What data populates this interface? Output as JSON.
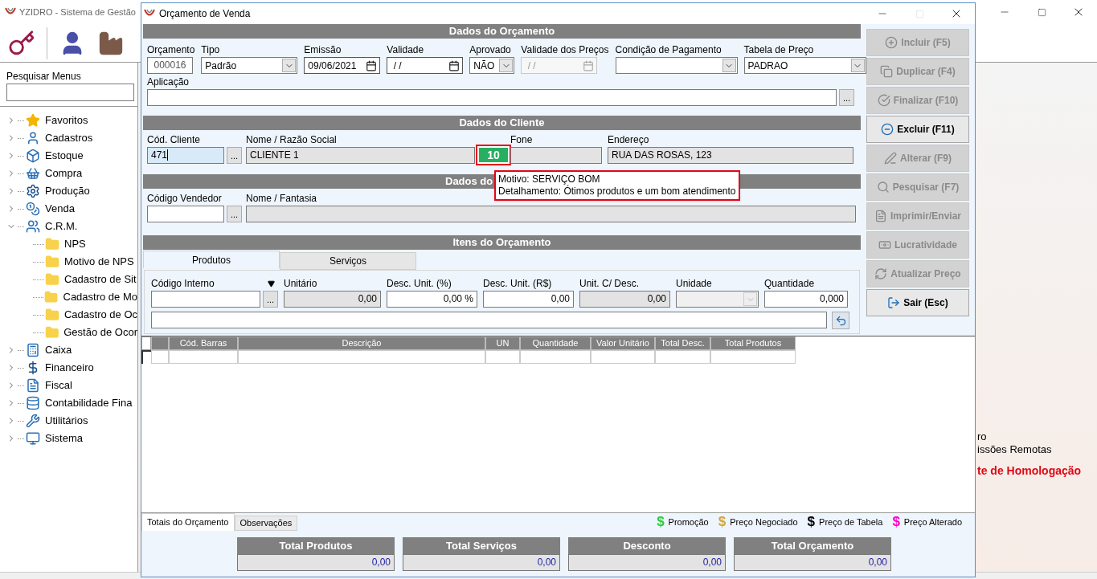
{
  "background_app": {
    "title": "YZIDRO - Sistema de Gestão",
    "search_label": "Pesquisar Menus",
    "menu_tree": [
      {
        "label": "Favoritos",
        "expanded": false
      },
      {
        "label": "Cadastros",
        "expanded": false
      },
      {
        "label": "Estoque",
        "expanded": false
      },
      {
        "label": "Compra",
        "expanded": false
      },
      {
        "label": "Produção",
        "expanded": false
      },
      {
        "label": "Venda",
        "expanded": false
      },
      {
        "label": "C.R.M.",
        "expanded": true,
        "children": [
          {
            "label": "NPS"
          },
          {
            "label": "Motivo de NPS"
          },
          {
            "label": "Cadastro de Sit"
          },
          {
            "label": "Cadastro de Mo"
          },
          {
            "label": "Cadastro de Oc"
          },
          {
            "label": "Gestão de Ocor"
          }
        ]
      },
      {
        "label": "Caixa",
        "expanded": false
      },
      {
        "label": "Financeiro",
        "expanded": false
      },
      {
        "label": "Fiscal",
        "expanded": false
      },
      {
        "label": "Contabilidade Fina",
        "expanded": false
      },
      {
        "label": "Utilitários",
        "expanded": false
      },
      {
        "label": "Sistema",
        "expanded": false
      }
    ],
    "notices": [
      {
        "text": "ro",
        "kind": "info"
      },
      {
        "text": "issões Remotas",
        "kind": "info"
      },
      {
        "text": "te de Homologação",
        "kind": "alert"
      }
    ]
  },
  "dialog": {
    "title": "Orçamento de Venda",
    "budget": {
      "header": "Dados do Orçamento",
      "fields": [
        {
          "label": "Orçamento",
          "value": "000016",
          "kind": "code"
        },
        {
          "label": "Tipo",
          "value": "Padrão",
          "kind": "combo"
        },
        {
          "label": "Emissão",
          "value": "09/06/2021",
          "kind": "date"
        },
        {
          "label": "Validade",
          "value": " / /",
          "kind": "date"
        },
        {
          "label": "Aprovado",
          "value": "NÃO",
          "kind": "combo"
        },
        {
          "label": "Validade dos Preços",
          "value": " / /",
          "kind": "date",
          "disabled": true
        },
        {
          "label": "Condição de Pagamento",
          "kind": "combo"
        },
        {
          "label": "Tabela de Preço",
          "value": "PADRAO",
          "kind": "combo"
        }
      ],
      "application": {
        "label": "Aplicação",
        "button": "..."
      }
    },
    "client": {
      "header": "Dados do Cliente",
      "code": {
        "label": "Cód. Cliente",
        "value": "471",
        "focused": true,
        "button": "..."
      },
      "name": {
        "label": "Nome / Razão Social",
        "value": "CLIENTE 1"
      },
      "nps_badge": "10",
      "phone": {
        "label": "Fone"
      },
      "address": {
        "label": "Endereço",
        "value": "RUA DAS ROSAS, 123"
      },
      "tooltip": [
        "Motivo: SERVIÇO BOM",
        "Detalhamento: Ótimos produtos e um bom atendimento"
      ]
    },
    "seller": {
      "header": "Dados do",
      "code": {
        "label": "Código Vendedor",
        "button": "..."
      },
      "name": {
        "label": "Nome / Fantasia"
      }
    },
    "items": {
      "header": "Itens do Orçamento",
      "tabs": [
        {
          "label": "Produtos",
          "selected": true
        },
        {
          "label": "Serviços",
          "selected": false
        }
      ],
      "fields": [
        {
          "label": "Código Interno",
          "kind": "lookup",
          "button": "...",
          "dropdown": true
        },
        {
          "label": "Unitário",
          "value": "0,00",
          "kind": "readonly"
        },
        {
          "label": "Desc. Unit. (%)",
          "value": "0,00 %",
          "kind": "text"
        },
        {
          "label": "Desc. Unit. (R$)",
          "value": "0,00",
          "kind": "text"
        },
        {
          "label": "Unit. C/ Desc.",
          "value": "0,00",
          "kind": "readonly"
        },
        {
          "label": "Unidade",
          "kind": "combo",
          "disabled": true
        },
        {
          "label": "Quantidade",
          "value": "0,000",
          "kind": "text"
        }
      ]
    },
    "grid": {
      "columns": [
        "Cód. Barras",
        "Descrição",
        "UN",
        "Quantidade",
        "Valor Unitário",
        "Total Desc.",
        "Total Produtos"
      ]
    },
    "side_buttons": [
      {
        "label": "Incluir (F5)",
        "enabled": false
      },
      {
        "label": "Duplicar (F4)",
        "enabled": false
      },
      {
        "label": "Finalizar (F10)",
        "enabled": false
      },
      {
        "label": "Excluir (F11)",
        "enabled": true
      },
      {
        "label": "Alterar (F9)",
        "enabled": false
      },
      {
        "label": "Pesquisar (F7)",
        "enabled": false
      },
      {
        "label": "Imprimir/Enviar",
        "enabled": false
      },
      {
        "label": "Lucratividade",
        "enabled": false
      },
      {
        "label": "Atualizar Preço",
        "enabled": false
      },
      {
        "label": "Sair (Esc)",
        "enabled": true
      }
    ],
    "bottom_tabs": [
      {
        "label": "Totais do Orçamento",
        "selected": true
      },
      {
        "label": "Observações",
        "selected": false
      }
    ],
    "legend": [
      {
        "symbol": "$",
        "label": "Promoção",
        "color": "#2ecc40"
      },
      {
        "symbol": "$",
        "label": "Preço Negociado",
        "color": "#d4a53c"
      },
      {
        "symbol": "$",
        "label": "Preço de Tabela",
        "color": "#000000"
      },
      {
        "symbol": "$",
        "label": "Preço Alterado",
        "color": "#ff00cc"
      }
    ],
    "totals": [
      {
        "label": "Total Produtos",
        "value": "0,00"
      },
      {
        "label": "Total Serviços",
        "value": "0,00"
      },
      {
        "label": "Desconto",
        "value": "0,00"
      },
      {
        "label": "Total Orçamento",
        "value": "0,00"
      }
    ]
  }
}
